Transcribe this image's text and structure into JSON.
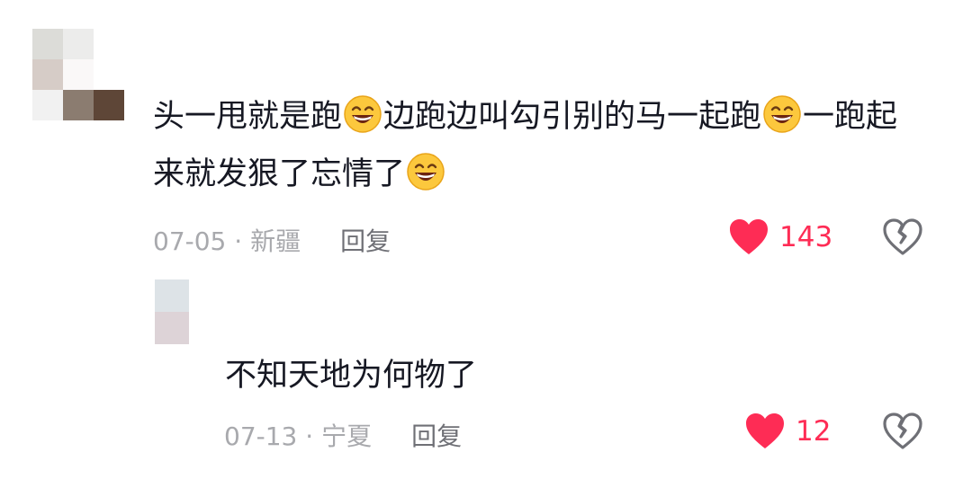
{
  "comments": [
    {
      "text_parts": [
        "头一甩就是跑",
        "边跑边叫勾引别的马一起跑",
        "一跑起来就发狠了忘情了"
      ],
      "emoji": "grinning-sweat-emoji",
      "date": "07-05",
      "location": "新疆",
      "separator": " · ",
      "reply_label": "回复",
      "likes": "143"
    },
    {
      "text": "不知天地为何物了",
      "date": "07-13",
      "location": "宁夏",
      "separator": " · ",
      "reply_label": "回复",
      "likes": "12"
    }
  ],
  "colors": {
    "text": "#161823",
    "meta": "#a8a9ad",
    "reply": "#6f7076",
    "like": "#fe2c55"
  }
}
